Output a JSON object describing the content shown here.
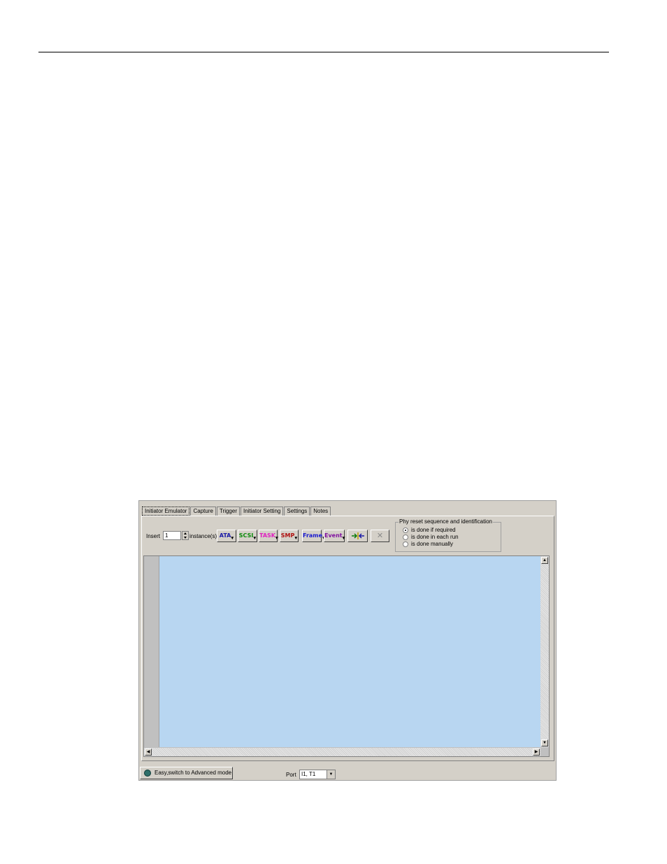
{
  "tabs": [
    {
      "label": "Initiator Emulator",
      "active": true
    },
    {
      "label": "Capture",
      "active": false
    },
    {
      "label": "Trigger",
      "active": false
    },
    {
      "label": "Initiator Setting",
      "active": false
    },
    {
      "label": "Settings",
      "active": false
    },
    {
      "label": "Notes",
      "active": false
    }
  ],
  "toolbar": {
    "insert_label": "Insert",
    "instances_value": "1",
    "instances_label": "instance(s)",
    "buttons": [
      {
        "label": "ATA",
        "color": "#1a1aa8"
      },
      {
        "label": "SCSI",
        "color": "#0a8a0a"
      },
      {
        "label": "TASK",
        "color": "#e020c0"
      },
      {
        "label": "SMP",
        "color": "#b01010"
      },
      {
        "label": "Frame",
        "color": "#1a1ad0"
      },
      {
        "label": "Event",
        "color": "#8010a0"
      }
    ]
  },
  "phy_group": {
    "title": "Phy reset sequence and identification",
    "options": [
      {
        "label": "is done if required",
        "selected": true
      },
      {
        "label": "is done in each run",
        "selected": false
      },
      {
        "label": "is done manually",
        "selected": false
      }
    ]
  },
  "footer": {
    "mode_button": "Easy,switch to Advanced mode",
    "port_label": "Port",
    "port_value": "I1, T1"
  }
}
